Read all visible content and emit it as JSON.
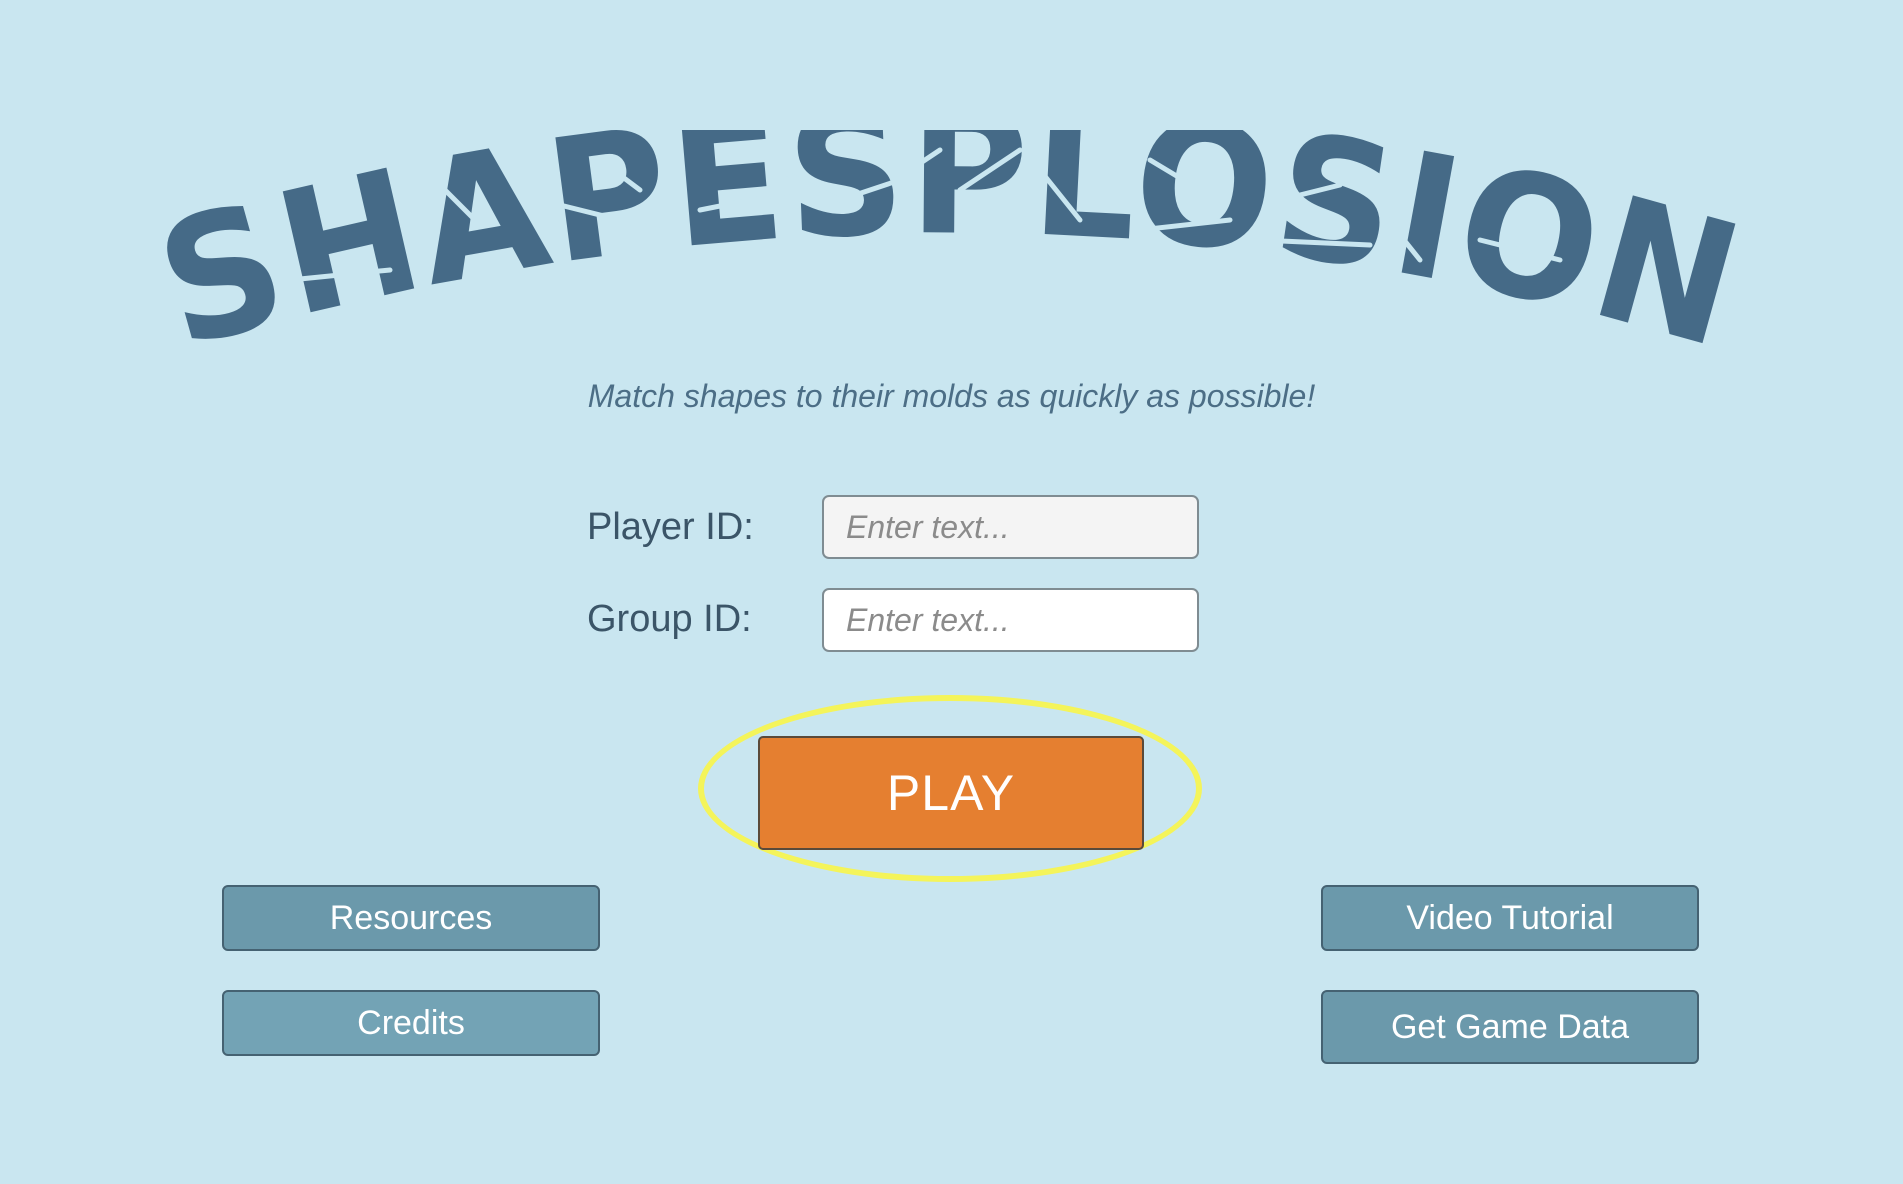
{
  "game": {
    "title": "SHAPESPLOSION",
    "subtitle": "Match shapes to their molds as quickly as possible!"
  },
  "form": {
    "player_id_label": "Player ID:",
    "player_id_placeholder": "Enter text...",
    "player_id_value": "",
    "group_id_label": "Group ID:",
    "group_id_placeholder": "Enter text...",
    "group_id_value": ""
  },
  "buttons": {
    "play": "PLAY",
    "resources": "Resources",
    "credits": "Credits",
    "video_tutorial": "Video Tutorial",
    "get_game_data": "Get Game Data"
  },
  "colors": {
    "background": "#c9e6f0",
    "title": "#456a87",
    "play_button": "#e57f30",
    "side_button": "#6b99ab",
    "highlight": "#f4f45a"
  }
}
